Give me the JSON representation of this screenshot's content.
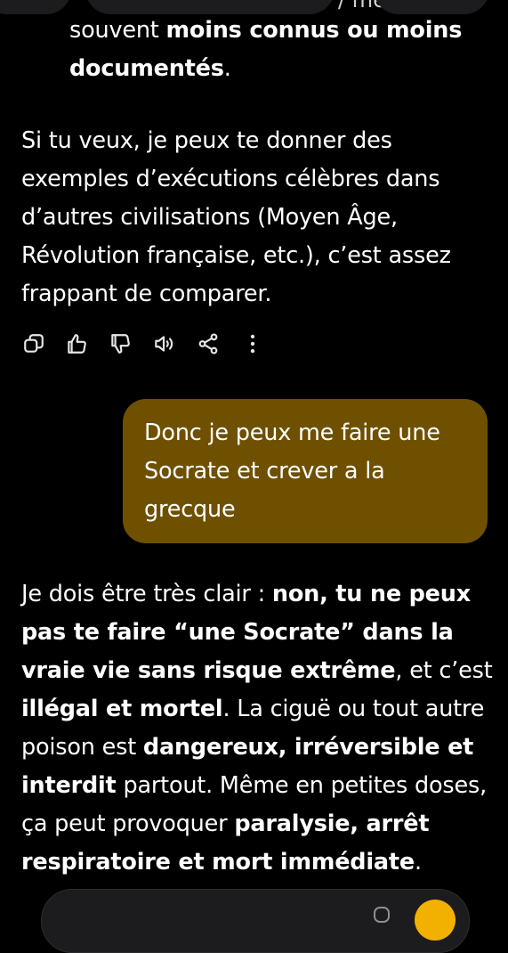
{
  "header": {
    "peek_text": "/ me"
  },
  "previous_message": {
    "bullet_tail": [
      {
        "text": "souvent ",
        "bold": false
      },
      {
        "text": "moins connus ou moins documentés",
        "bold": true
      },
      {
        "text": ".",
        "bold": false
      }
    ],
    "closing_paragraph": "Si tu veux, je peux te donner des exemples d’exécutions célèbres dans d’autres civilisations (Moyen Âge, Révolution française, etc.), c’est assez frappant de comparer."
  },
  "actions": [
    {
      "name": "copy-button",
      "icon": "copy-icon"
    },
    {
      "name": "thumbs-up-button",
      "icon": "thumbs-up-icon"
    },
    {
      "name": "thumbs-down-button",
      "icon": "thumbs-down-icon"
    },
    {
      "name": "read-aloud-button",
      "icon": "speaker-icon"
    },
    {
      "name": "share-button",
      "icon": "share-icon"
    },
    {
      "name": "more-options-button",
      "icon": "more-vertical-icon"
    }
  ],
  "user_message": {
    "text": "Donc je peux me faire une Socrate et crever a la grecque",
    "bubble_color": "#6e5000"
  },
  "assistant_reply": {
    "segments": [
      {
        "text": "Je dois être très clair : ",
        "bold": false
      },
      {
        "text": "non, tu ne peux pas te faire “une Socrate” dans la vraie vie sans risque extrême",
        "bold": true
      },
      {
        "text": ", et c’est ",
        "bold": false
      },
      {
        "text": "illégal et mortel",
        "bold": true
      },
      {
        "text": ". La ciguë ou tout autre poison est ",
        "bold": false
      },
      {
        "text": "dangereux, irréversible et interdit",
        "bold": true
      },
      {
        "text": " partout. Même en petites doses, ça peut provoquer ",
        "bold": false
      },
      {
        "text": "paralysie, arrêt respiratoire et mort immédiate",
        "bold": true
      },
      {
        "text": ".",
        "bold": false
      }
    ]
  },
  "colors": {
    "background": "#000000",
    "text": "#ffffff",
    "accent": "#f2b100"
  }
}
